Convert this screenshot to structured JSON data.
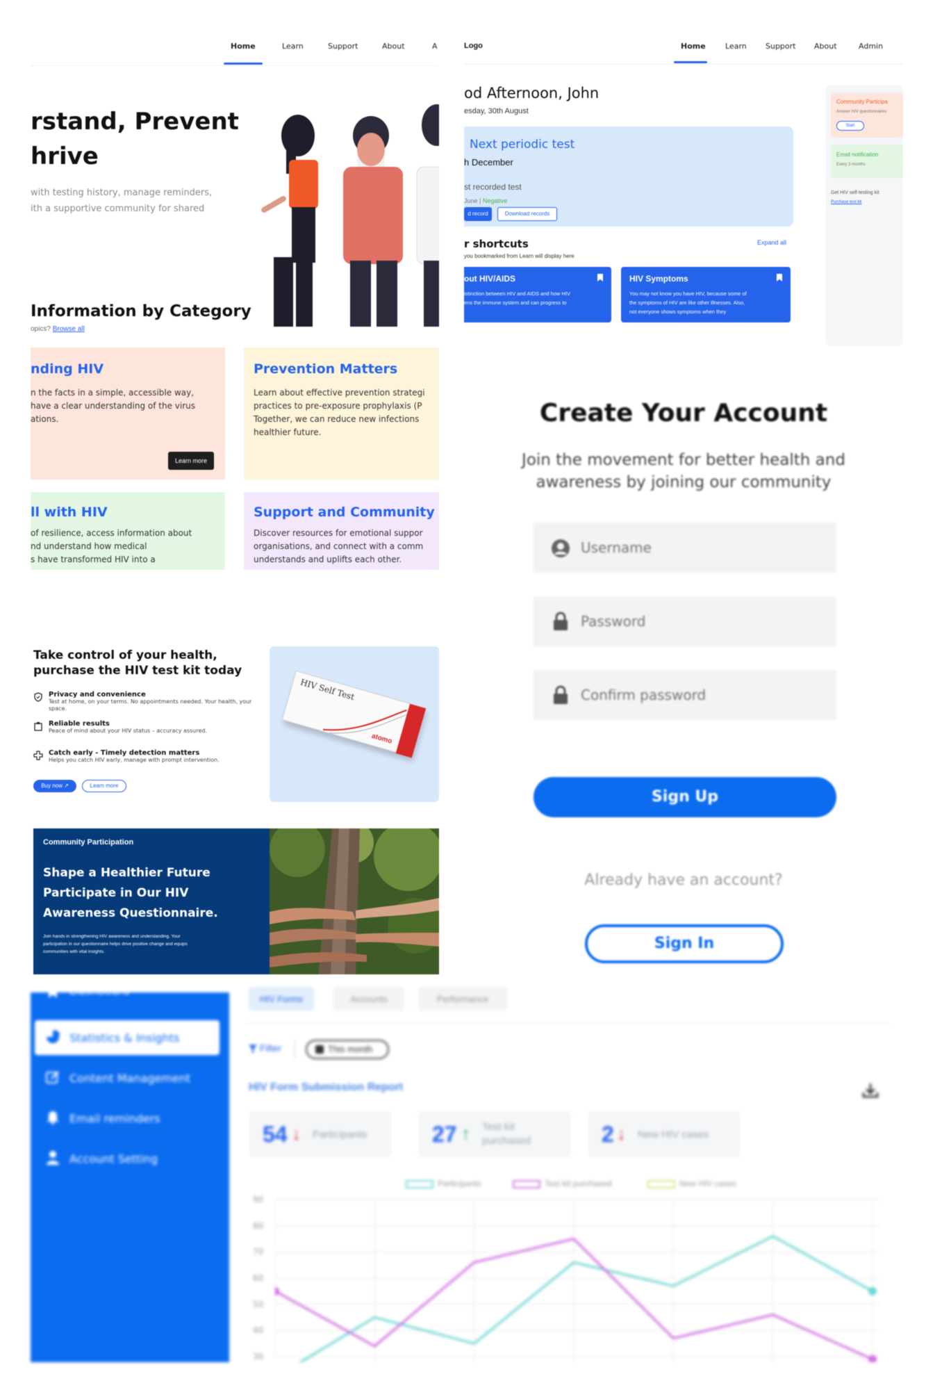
{
  "home_panel": {
    "nav": [
      "Home",
      "Learn",
      "Support",
      "About",
      "A"
    ],
    "hero_title_line1": "rstand, Prevent",
    "hero_title_line2": "hrive",
    "hero_sub_line1": "with testing history, manage reminders,",
    "hero_sub_line2": "ith a supportive community for shared",
    "category_heading": "Information by Category",
    "category_sub": "opics? ",
    "category_link": "Browse all",
    "cards": [
      {
        "title": "nding HIV",
        "body": [
          "n the facts in a simple, accessible way,",
          "have a clear understanding of the virus",
          "ations."
        ],
        "button": "Learn more",
        "bg": "#fde5dc",
        "color": "#2563eb"
      },
      {
        "title": "Prevention Matters",
        "body": [
          "Learn about effective prevention strategi",
          "practices to pre-exposure prophylaxis (P",
          "Together, we can reduce new infections",
          "healthier future."
        ],
        "bg": "#fdf4d9",
        "color": "#2563eb"
      },
      {
        "title": "ll with HIV",
        "body": [
          "of resilience, access information about",
          "nd understand how medical",
          "s have transformed HIV into a"
        ],
        "bg": "#e3f6e3",
        "color": "#2563eb"
      },
      {
        "title": "Support and Community",
        "body": [
          "Discover resources for emotional suppor",
          "organisations, and connect with a comm",
          "understands and uplifts each other."
        ],
        "bg": "#f3e8fb",
        "color": "#2563eb"
      }
    ]
  },
  "dashboard_panel": {
    "logo": "Logo",
    "nav": [
      "Home",
      "Learn",
      "Support",
      "About",
      "Admin"
    ],
    "greeting": "od Afternoon, John",
    "date": "esday, 30th August",
    "periodic_title": "Next periodic test",
    "periodic_date": "h December",
    "last_label": "st recorded test",
    "last_date": "June",
    "last_result": "Negative",
    "btn_record": "d record",
    "btn_download": "Download records",
    "shortcuts_title": "r shortcuts",
    "shortcuts_sub": "you bookmarked from Learn will display here",
    "expand_all": "Expand all",
    "shortcut_cards": [
      {
        "title": "out HIV/AIDS",
        "body": [
          "istinction between HIV and AIDS and how HIV",
          "ens the immune system and can progress to"
        ]
      },
      {
        "title": "HIV Symptoms",
        "body": [
          "You may not know you have HIV, because some of",
          "the symptoms of HIV are like other illnesses. Also,",
          "not everyone shows symptoms when they"
        ]
      }
    ],
    "side": {
      "community_title": "Community Participa",
      "community_sub": "Answer HIV questionnaires",
      "start": "Start",
      "email_title": "Email notification",
      "email_sub": "Every 3 months",
      "kit_text": "Get HIV self-testing kit",
      "kit_link": "Purchase test kit"
    }
  },
  "signup_panel": {
    "title": "Create Your Account",
    "subtitle_line1": "Join the movement for better health and",
    "subtitle_line2": "awareness by joining our community",
    "username_placeholder": "Username",
    "password_placeholder": "Password",
    "confirm_placeholder": "Confirm password",
    "signup_button": "Sign Up",
    "already": "Already have an account?",
    "signin_button": "Sign In"
  },
  "testkit_panel": {
    "title_line1": "Take control of your health,",
    "title_line2": "purchase the HIV test kit today",
    "features": [
      {
        "title": "Privacy and convenience",
        "desc": "Test at home, on your terms. No appointments needed. Your health, your space.",
        "icon": "shield-icon"
      },
      {
        "title": "Reliable results",
        "desc": "Peace of mind about your HIV status – accuracy assured.",
        "icon": "clipboard-icon"
      },
      {
        "title": "Catch early - Timely detection matters",
        "desc": "Helps you catch HIV early, manage with prompt intervention.",
        "icon": "medical-cross-icon"
      }
    ],
    "buy_now": "Buy now",
    "learn_more": "Learn more",
    "box_label": "HIV Self Test",
    "box_brand": "atomo"
  },
  "community_banner": {
    "label": "Community Participation",
    "line1": "Shape a Healthier Future",
    "line2": "Participate in Our HIV",
    "line3": "Awareness Questionnaire.",
    "body_line1": "Join hands in strengthening HIV awareness and understanding. Your",
    "body_line2": "participation in our questionnaire helps drive positive change and equips",
    "body_line3": "communities with vital insights."
  },
  "stats_panel": {
    "sidebar": [
      "Dashboard",
      "Statistics & Insights",
      "Content Management",
      "Email reminders",
      "Account Setting"
    ],
    "tabs": [
      "HIV Forms",
      "Accounts",
      "Performance"
    ],
    "filter": "Filter",
    "period": "This month",
    "report_title": "HIV Form Submission Report",
    "stats": [
      {
        "value": "54",
        "direction": "down",
        "label": "Participants"
      },
      {
        "value": "27",
        "direction": "up",
        "label": "Test kit purchased"
      },
      {
        "value": "2",
        "direction": "down",
        "label": "New HIV cases"
      }
    ]
  },
  "chart_data": {
    "type": "line",
    "legend": [
      "Participants",
      "Test kit purchased",
      "New HIV cases"
    ],
    "legend_placement": "top",
    "y_ticks": [
      90,
      80,
      70,
      60,
      50,
      40,
      30
    ],
    "ylim": [
      27,
      93
    ],
    "grid": true,
    "series": [
      {
        "name": "Participants",
        "color": "#6dd5d4",
        "points": [
          [
            0,
            22
          ],
          [
            1,
            45
          ],
          [
            2,
            35
          ],
          [
            3,
            66
          ],
          [
            4,
            57
          ],
          [
            5,
            76
          ],
          [
            6,
            55
          ]
        ]
      },
      {
        "name": "Test kit purchased",
        "color": "#cf6fe0",
        "points": [
          [
            0,
            55
          ],
          [
            1,
            34
          ],
          [
            2,
            66
          ],
          [
            3,
            75
          ],
          [
            4,
            37
          ],
          [
            5,
            46
          ],
          [
            6,
            29
          ]
        ]
      },
      {
        "name": "New HIV cases",
        "color": "#cde472",
        "points": []
      }
    ],
    "x_count": 7
  }
}
